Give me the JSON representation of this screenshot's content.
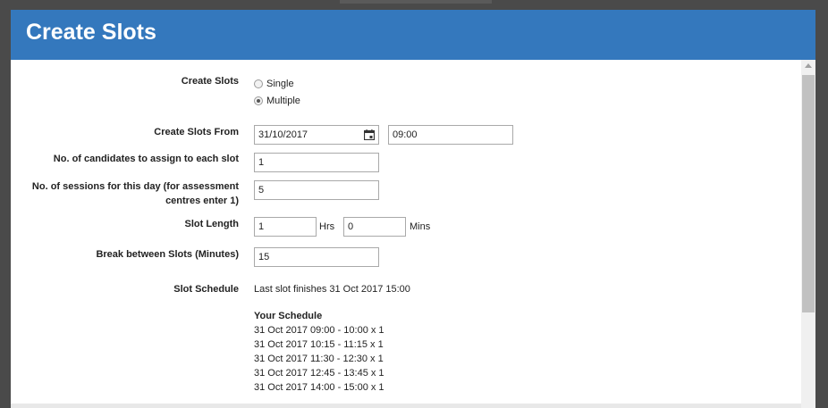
{
  "modal": {
    "title": "Create Slots"
  },
  "form": {
    "create_slots": {
      "label": "Create Slots",
      "options": [
        {
          "label": "Single",
          "checked": false
        },
        {
          "label": "Multiple",
          "checked": true
        }
      ]
    },
    "create_slots_from": {
      "label": "Create Slots From",
      "date": "31/10/2017",
      "time": "09:00",
      "date_icon": "calendar-icon"
    },
    "candidates": {
      "label": "No. of candidates to assign to each slot",
      "value": "1"
    },
    "sessions": {
      "label_line1": "No. of sessions for this day (for assessment",
      "label_line2": "centres enter 1)",
      "value": "5"
    },
    "slot_length": {
      "label": "Slot Length",
      "hours": "1",
      "hours_unit": "Hrs",
      "mins": "0",
      "mins_unit": "Mins"
    },
    "break": {
      "label": "Break between Slots (Minutes)",
      "value": "15"
    },
    "slot_schedule": {
      "label": "Slot Schedule",
      "text": "Last slot finishes 31 Oct 2017 15:00"
    }
  },
  "schedule": {
    "title": "Your Schedule",
    "items": [
      "31 Oct 2017 09:00 - 10:00 x 1",
      "31 Oct 2017 10:15 - 11:15 x 1",
      "31 Oct 2017 11:30 - 12:30 x 1",
      "31 Oct 2017 12:45 - 13:45 x 1",
      "31 Oct 2017 14:00 - 15:00 x 1"
    ]
  },
  "colors": {
    "header": "#3478bd",
    "backdrop": "#4a4a4a"
  }
}
